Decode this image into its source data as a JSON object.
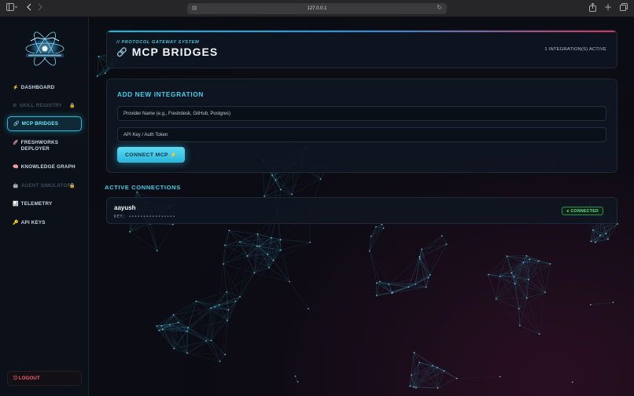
{
  "browser": {
    "url": "127.0.0.1",
    "icons": [
      "sidebar-toggle-icon",
      "chevron-left-icon",
      "chevron-right-icon",
      "share-icon",
      "new-tab-icon",
      "tabs-overview-icon"
    ]
  },
  "sidebar": {
    "items": [
      {
        "icon": "⚡",
        "label": "DASHBOARD",
        "state": "normal"
      },
      {
        "icon": "⚙",
        "label": "SKILL REGISTRY",
        "state": "disabled",
        "lock": "🔒"
      },
      {
        "icon": "🔗",
        "label": "MCP BRIDGES",
        "state": "active"
      },
      {
        "icon": "🚀",
        "label": "FRESHWORKS DEPLOYER",
        "state": "normal"
      },
      {
        "icon": "🧠",
        "label": "KNOWLEDGE GRAPH",
        "state": "normal"
      },
      {
        "icon": "🤖",
        "label": "AGENT SIMULATOR",
        "state": "disabled",
        "lock": "🔒"
      },
      {
        "icon": "📊",
        "label": "TELEMETRY",
        "state": "normal"
      },
      {
        "icon": "🔑",
        "label": "API KEYS",
        "state": "normal"
      }
    ],
    "logout_label": "⎋ LOGOUT"
  },
  "header": {
    "subtitle": "// PROTOCOL GATEWAY SYSTEM",
    "title": "MCP BRIDGES",
    "title_icon": "🔗",
    "active_count": "1 INTEGRATION(S) ACTIVE"
  },
  "form": {
    "title": "ADD NEW INTEGRATION",
    "provider_placeholder": "Provider Name (e.g., Freshdesk, GitHub, Postgres)",
    "token_placeholder": "API Key / Auth Token",
    "connect_label": "CONNECT MCP ⚡"
  },
  "connections": {
    "title": "ACTIVE CONNECTIONS",
    "items": [
      {
        "name": "aayush",
        "key": "KEY: ••••••••••••••••",
        "status": "● CONNECTED"
      }
    ]
  },
  "colors": {
    "accent": "#3fd0ea",
    "connected": "#62e08b",
    "logout": "#ff5a6e",
    "background": "#0a0d14"
  }
}
